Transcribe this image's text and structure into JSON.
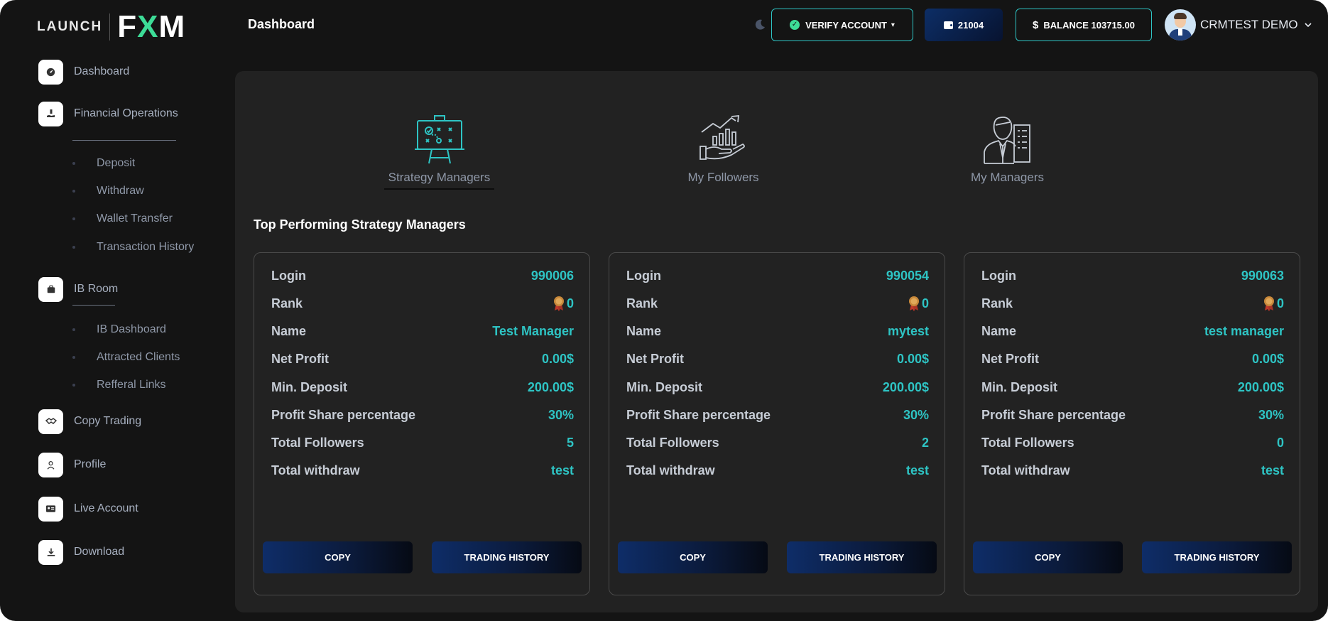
{
  "brand": {
    "part1": "LAUNCH",
    "part2_a": "F",
    "part2_b": "X",
    "part2_c": "M"
  },
  "header": {
    "page_title": "Dashboard",
    "verify_label": "VERIFY ACCOUNT",
    "wallet_id": "21004",
    "balance_label": "BALANCE 103715.00",
    "user_name": "CRMTEST DEMO"
  },
  "sidebar": {
    "dashboard": "Dashboard",
    "financial": "Financial Operations",
    "financial_sub": [
      "Deposit",
      "Withdraw",
      "Wallet Transfer",
      "Transaction History"
    ],
    "ib_room": "IB Room",
    "ib_sub": [
      "IB Dashboard",
      "Attracted Clients",
      "Refferal Links"
    ],
    "copy_trading": "Copy Trading",
    "profile": "Profile",
    "live_account": "Live Account",
    "download": "Download"
  },
  "tabs": [
    "Strategy Managers",
    "My Followers",
    "My Managers"
  ],
  "section_title": "Top Performing Strategy Managers",
  "row_labels": [
    "Login",
    "Rank",
    "Name",
    "Net Profit",
    "Min. Deposit",
    "Profit Share percentage",
    "Total Followers",
    "Total withdraw"
  ],
  "cards": [
    {
      "login": "990006",
      "rank": "0",
      "name": "Test Manager",
      "net_profit": "0.00$",
      "min_deposit": "200.00$",
      "profit_share": "30%",
      "followers": "5",
      "withdraw": "test"
    },
    {
      "login": "990054",
      "rank": "0",
      "name": "mytest",
      "net_profit": "0.00$",
      "min_deposit": "200.00$",
      "profit_share": "30%",
      "followers": "2",
      "withdraw": "test"
    },
    {
      "login": "990063",
      "rank": "0",
      "name": "test manager",
      "net_profit": "0.00$",
      "min_deposit": "200.00$",
      "profit_share": "30%",
      "followers": "0",
      "withdraw": "test"
    }
  ],
  "buttons": {
    "copy": "COPY",
    "history": "TRADING HISTORY"
  },
  "colors": {
    "accent": "#2ec4c4",
    "brand_green": "#3ddc97",
    "button_blue": "#0e2d68",
    "panel": "#222222",
    "background": "#141414"
  },
  "icons": {
    "dashboard": "speedometer-icon",
    "financial": "hand-money-icon",
    "ib_room": "briefcase-icon",
    "copy_trading": "handshake-icon",
    "profile": "user-icon",
    "live_account": "id-card-icon",
    "download": "download-icon",
    "theme": "moon-icon",
    "verify": "check-circle-icon",
    "wallet": "wallet-icon",
    "rank": "medal-icon"
  }
}
